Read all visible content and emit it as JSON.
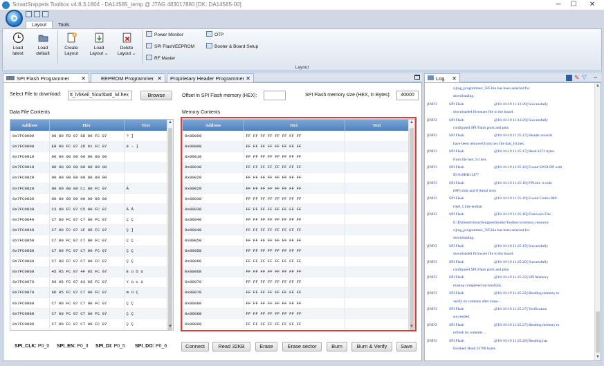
{
  "window": {
    "title": "SmartSnippets Toolbox v4.8.3.1804 - DA14585_temp @ JTAG 483017880 [DK: DA14585-00]",
    "minimize": "─",
    "maximize": "☐",
    "close": "✕"
  },
  "ribbon_tabs": [
    "Layout",
    "Tools"
  ],
  "ribbon": {
    "buttons": [
      {
        "label1": "Load",
        "label2": "latest",
        "icon": "clock-icon"
      },
      {
        "label1": "Load",
        "label2": "default",
        "icon": "folder-icon"
      },
      {
        "label1": "Create",
        "label2": "Layout",
        "icon": "new-layout-icon"
      },
      {
        "label1": "Load",
        "label2": "Layout ⌄",
        "icon": "load-layout-icon"
      },
      {
        "label1": "Delete",
        "label2": "Layout ⌄",
        "icon": "delete-layout-icon"
      }
    ],
    "small": [
      "Power Monitor",
      "SPI Flash/EEPROM",
      "RF Master",
      "OTP",
      "Booter & Board Setup"
    ],
    "group_label": "Layout"
  },
  "doc_tabs": [
    "SPI Flash Programmer",
    "EEPROM Programmer",
    "Proprietary Header Programmer"
  ],
  "spi": {
    "file_label": "Select File to download:",
    "file_value": "tt_lvl\\Keil_5\\out\\batt_lvl.hex",
    "browse": "Browse",
    "offset_label": "Offset in SPI Flash memory (HEX):",
    "offset_value": "",
    "size_label": "SPI Flash memory size (HEX, in Bytes):",
    "size_value": "40000",
    "data_file_label": "Data File Contents",
    "memory_label": "Memory Contents",
    "columns": [
      "Address",
      "Hex",
      "Text"
    ],
    "data_rows": [
      [
        "0x7FC0000",
        "00 80 FD 07 5D 00 FC 07",
        "?    ]"
      ],
      [
        "0x7FC0008",
        "E8 00 FC 07 2D 01 FC 07",
        "è    -   ]"
      ],
      [
        "0x7FC0010",
        "00 00 00 00 00 00 00 00",
        ""
      ],
      [
        "0x7FC0018",
        "00 00 00 00 00 00 00 00",
        ""
      ],
      [
        "0x7FC0020",
        "00 00 00 00 00 00 00 00",
        ""
      ],
      [
        "0x7FC0028",
        "00 00 00 00 C1 00 FC 07",
        "Á"
      ],
      [
        "0x7FC0030",
        "00 00 00 00 00 00 00 00",
        ""
      ],
      [
        "0x7FC0038",
        "C3 00 FC 07 C5 00 FC 07",
        "Ã    Å"
      ],
      [
        "0x7FC0040",
        "C7 00 FC 07 C7 00 FC 07",
        "Ç    Ç"
      ],
      [
        "0x7FC0048",
        "C7 00 FC 07 1F 0D FC 07",
        "Ç    ]"
      ],
      [
        "0x7FC0050",
        "C7 00 FC 07 C7 00 FC 07",
        "Ç    Ç"
      ],
      [
        "0x7FC0058",
        "C7 00 FC 07 C7 00 FC 07",
        "Ç    Ç"
      ],
      [
        "0x7FC0060",
        "C7 00 FC 07 C7 00 FC 07",
        "Ç    Ç"
      ],
      [
        "0x7FC0068",
        "45 05 FC 07 4F 05 FC 07",
        "E  ü  O  ü"
      ],
      [
        "0x7FC0070",
        "59 05 FC 07 63 05 FC 07",
        "Y  ü  c  ü"
      ],
      [
        "0x7FC0078",
        "6D 05 FC 07 C7 00 FC 07",
        "m  ü    Ç"
      ],
      [
        "0x7FC0080",
        "C7 00 FC 07 C7 00 FC 07",
        "Ç    Ç"
      ],
      [
        "0x7FC0088",
        "C7 00 FC 07 C7 00 FC 07",
        "Ç    Ç"
      ],
      [
        "0x7FC0090",
        "C7 00 FC 07 C7 00 FC 07",
        "Ç    Ç"
      ]
    ],
    "mem_rows": [
      [
        "0x00000",
        "FF FF FF FF FF FF FF FF",
        ""
      ],
      [
        "0x00008",
        "FF FF FF FF FF FF FF FF",
        ""
      ],
      [
        "0x00010",
        "FF FF FF FF FF FF FF FF",
        ""
      ],
      [
        "0x00018",
        "FF FF FF FF FF FF FF FF",
        ""
      ],
      [
        "0x00020",
        "FF FF FF FF FF FF FF FF",
        ""
      ],
      [
        "0x00028",
        "FF FF FF FF FF FF FF FF",
        ""
      ],
      [
        "0x00030",
        "FF FF FF FF FF FF FF FF",
        ""
      ],
      [
        "0x00038",
        "FF FF FF FF FF FF FF FF",
        ""
      ],
      [
        "0x00040",
        "FF FF FF FF FF FF FF FF",
        ""
      ],
      [
        "0x00048",
        "FF FF FF FF FF FF FF FF",
        ""
      ],
      [
        "0x00050",
        "FF FF FF FF FF FF FF FF",
        ""
      ],
      [
        "0x00058",
        "FF FF FF FF FF FF FF FF",
        ""
      ],
      [
        "0x00060",
        "FF FF FF FF FF FF FF FF",
        ""
      ],
      [
        "0x00068",
        "FF FF FF FF FF FF FF FF",
        ""
      ],
      [
        "0x00070",
        "FF FF FF FF FF FF FF FF",
        ""
      ],
      [
        "0x00078",
        "FF FF FF FF FF FF FF FF",
        ""
      ],
      [
        "0x00080",
        "FF FF FF FF FF FF FF FF",
        ""
      ],
      [
        "0x00088",
        "FF FF FF FF FF FF FF FF",
        ""
      ],
      [
        "0x00090",
        "FF FF FF FF FF FF FF FF",
        ""
      ]
    ],
    "pins": [
      {
        "name": "SPI_CLK:",
        "value": "P0_0"
      },
      {
        "name": "SPI_EN:",
        "value": "P0_3"
      },
      {
        "name": "SPI_DI:",
        "value": "P0_5"
      },
      {
        "name": "SPI_DO:",
        "value": "P0_6"
      }
    ],
    "actions": [
      "Connect",
      "Read 32KB",
      "Erase",
      "Erase sector",
      "Burn",
      "Burn & Verify",
      "Save"
    ]
  },
  "log": {
    "tab": "Log",
    "lines": [
      {
        "cont": "s\\jtag_programmer_585.bin has been selected for"
      },
      {
        "cont": "downloading."
      },
      {
        "level": "[INFO",
        "source": "SPI Flash",
        "msg": "@18-10-19 11:13:29] Successfully"
      },
      {
        "cont": "downloaded firmware file to the board."
      },
      {
        "level": "[INFO",
        "source": "SPI Flash",
        "msg": "@18-10-19 11:13:29] Successfully"
      },
      {
        "cont": "configured SPI Flash ports and pins."
      },
      {
        "level": "[INFO",
        "source": "SPI Flash",
        "msg": "@18-10-19 11:25:17] Header records"
      },
      {
        "cont": "have been removed from hex file batt_lvl.hex."
      },
      {
        "level": "[INFO",
        "source": "SPI Flash",
        "msg": "@18-10-19 11:25:17] Read 4372 bytes"
      },
      {
        "cont": "from file batt_lvl.hex."
      },
      {
        "level": "[INFO",
        "source": "SPI Flash",
        "msg": "@18-10-19 11:25:18] Found SWD-DP with"
      },
      {
        "cont": "ID 0x0BB11477"
      },
      {
        "level": "[INFO",
        "source": "SPI Flash",
        "msg": "@18-10-19 11:25:18] FPUnit: 4 code"
      },
      {
        "cont": "(BP) slots and 0 literal slots"
      },
      {
        "level": "[INFO",
        "source": "SPI Flash",
        "msg": "@18-10-19 11:25:18] Found Cortex-M0"
      },
      {
        "cont": "r0p0, Little endian."
      },
      {
        "level": "[INFO",
        "source": "SPI Flash",
        "msg": "@18-10-19 11:25:18] Firmware File"
      },
      {
        "cont": "E:\\DiaSemi\\SmartSnippetsStudio\\Toolbox\\common_resource"
      },
      {
        "cont": "s\\jtag_programmer_585.bin has been selected for"
      },
      {
        "cont": "downloading."
      },
      {
        "level": "[INFO",
        "source": "SPI Flash",
        "msg": "@18-10-19 11:25:19] Successfully"
      },
      {
        "cont": "downloaded firmware file to the board."
      },
      {
        "level": "[INFO",
        "source": "SPI Flash",
        "msg": "@18-10-19 11:25:20] Successfully"
      },
      {
        "cont": "configured SPI Flash ports and pins."
      },
      {
        "level": "[INFO",
        "source": "SPI Flash",
        "msg": "@18-10-19 11:25:22] SPI Memory"
      },
      {
        "cont": "erasing completed successfully."
      },
      {
        "level": "[INFO",
        "source": "SPI Flash",
        "msg": "@18-10-19 11:25:22] Reading memory to"
      },
      {
        "cont": "verify its contents after erase..."
      },
      {
        "level": "[INFO",
        "source": "SPI Flash",
        "msg": "@18-10-19 11:25:27] Verification"
      },
      {
        "cont": "succeeded."
      },
      {
        "level": "[INFO",
        "source": "SPI Flash",
        "msg": "@18-10-19 11:25:27] Reading memory to"
      },
      {
        "cont": "refresh its contents ..."
      },
      {
        "level": "[INFO",
        "source": "SPI Flash",
        "msg": "@18-10-19 11:25:28] Reading has"
      },
      {
        "cont": "finished. Read 32768 bytes"
      }
    ]
  }
}
